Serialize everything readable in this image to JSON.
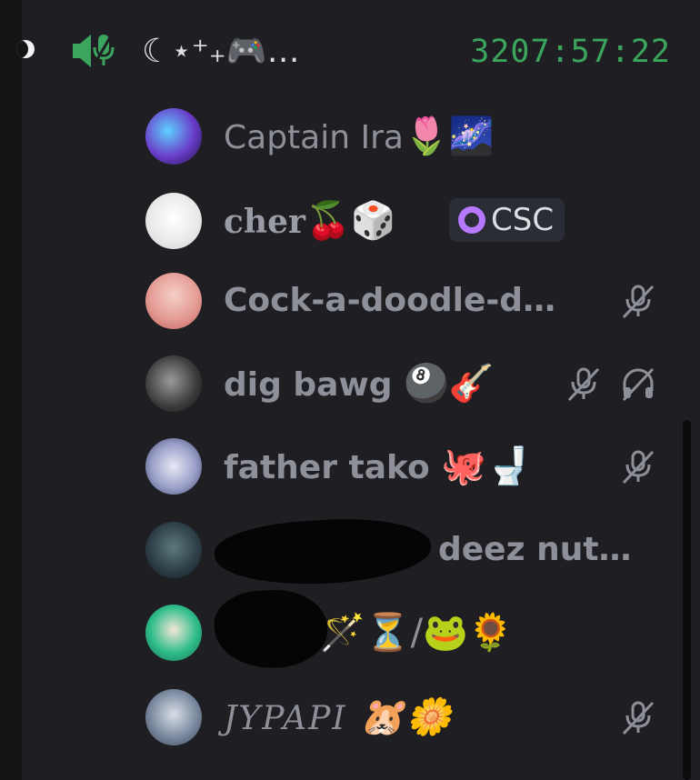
{
  "channel": {
    "name": "☾⋆⁺₊🎮…",
    "timer": "3207:57:22"
  },
  "members": [
    {
      "name": "Captain Ira",
      "emojis": "🌷🌌",
      "avatar_color": "#6a3cc9"
    },
    {
      "name": "cher",
      "emojis": "🍒🎲",
      "tag": "CSC",
      "avatar_color": "#f4f4f4"
    },
    {
      "name": "Cock-a-doodle-d…",
      "emojis": "",
      "avatar_color": "#e39b94",
      "muted": true
    },
    {
      "name": "dig bawg",
      "emojis": "🎱🎸",
      "avatar_color": "#3a3a3a",
      "muted": true,
      "deafened": true
    },
    {
      "name": "father tako",
      "emojis": "🐙🚽",
      "avatar_color": "#9aa0c8",
      "muted": true
    },
    {
      "name": "deez nut…",
      "emojis": "",
      "avatar_color": "#2c3c45"
    },
    {
      "name": "",
      "emojis": "🪄⏳/🐸🌻",
      "avatar_color": "#2ebd8a"
    },
    {
      "name": "JYPAPI",
      "emojis": "🐹🌼",
      "avatar_color": "#7c8aa0",
      "muted": true
    }
  ],
  "colors": {
    "background": "#1f1f23",
    "timer": "#3ba55d",
    "speaker": "#3ba55d",
    "username": "#8e9099"
  },
  "icons": {
    "speaker": "speaker-connected-icon",
    "muted": "mic-muted-icon",
    "deafened": "headphones-deafened-icon"
  }
}
